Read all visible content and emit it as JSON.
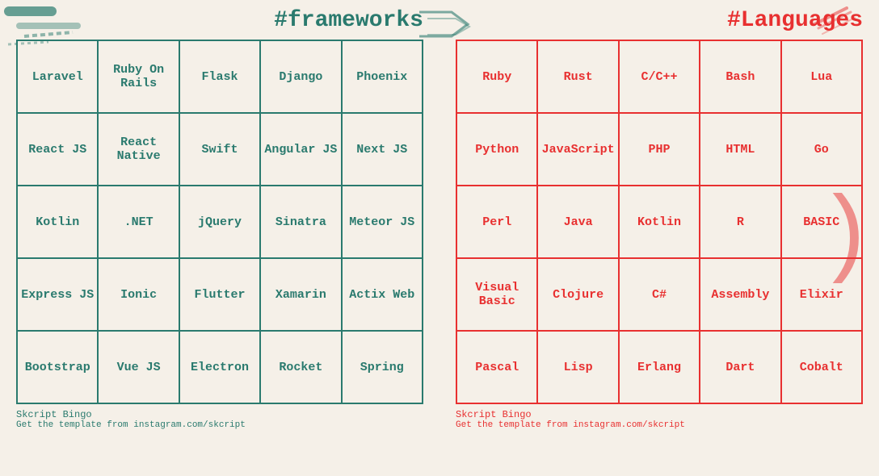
{
  "left_panel": {
    "title": "#frameworks",
    "accent_color": "#2a7a6e",
    "grid": [
      [
        "Laravel",
        "Ruby On Rails",
        "Flask",
        "Django",
        "Phoenix"
      ],
      [
        "React JS",
        "React Native",
        "Swift",
        "Angular JS",
        "Next JS"
      ],
      [
        "Kotlin",
        ".NET",
        "jQuery",
        "Sinatra",
        "Meteor JS"
      ],
      [
        "Express JS",
        "Ionic",
        "Flutter",
        "Xamarin",
        "Actix Web"
      ],
      [
        "Bootstrap",
        "Vue JS",
        "Electron",
        "Rocket",
        "Spring"
      ]
    ],
    "footer_brand": "Skcript Bingo",
    "footer_insta": "Get the template from instagram.com/skcript"
  },
  "right_panel": {
    "title": "#Languages",
    "accent_color": "#e83030",
    "grid": [
      [
        "Ruby",
        "Rust",
        "C/C++",
        "Bash",
        "Lua"
      ],
      [
        "Python",
        "JavaScript",
        "PHP",
        "HTML",
        "Go"
      ],
      [
        "Perl",
        "Java",
        "Kotlin",
        "R",
        "BASIC"
      ],
      [
        "Visual Basic",
        "Clojure",
        "C#",
        "Assembly",
        "Elixir"
      ],
      [
        "Pascal",
        "Lisp",
        "Erlang",
        "Dart",
        "Cobalt"
      ]
    ],
    "footer_brand": "Skcript Bingo",
    "footer_insta": "Get the template from instagram.com/skcript"
  }
}
